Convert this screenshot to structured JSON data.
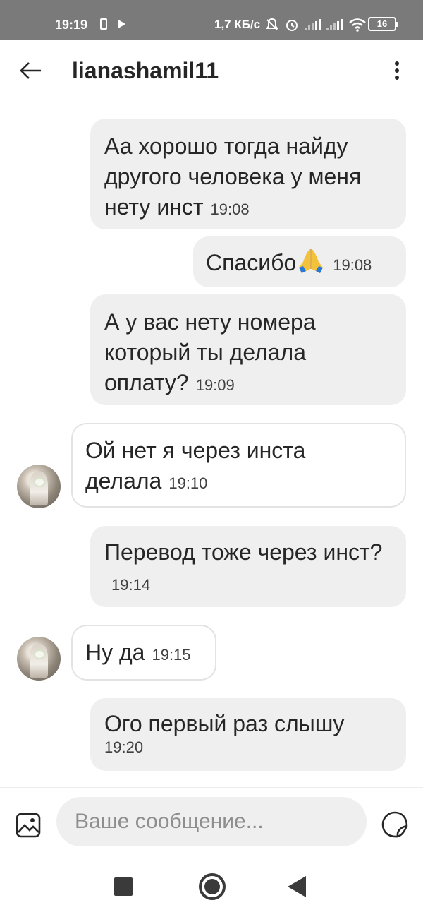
{
  "status_bar": {
    "time": "19:19",
    "network_speed": "1,7 КБ/с",
    "battery": "16"
  },
  "header": {
    "title": "lianashamil11"
  },
  "messages": [
    {
      "direction": "outgoing",
      "text": "Аа хорошо тогда найду другого человека у меня нету инст",
      "time": "19:08"
    },
    {
      "direction": "outgoing",
      "text": "Спасибо",
      "time": "19:08",
      "emoji": "folded-hands"
    },
    {
      "direction": "outgoing",
      "text": "А у вас нету номера который ты делала оплату?",
      "time": "19:09"
    },
    {
      "direction": "incoming",
      "text": "Ой нет я через инста делала",
      "time": "19:10"
    },
    {
      "direction": "outgoing",
      "text": "Перевод тоже через инст?",
      "time": "19:14"
    },
    {
      "direction": "incoming",
      "text": "Ну да",
      "time": "19:15"
    },
    {
      "direction": "outgoing",
      "text": "Ого первый раз слышу",
      "time": "19:20"
    }
  ],
  "composer": {
    "placeholder": "Ваше сообщение..."
  },
  "icons": {
    "back": "arrow-left-icon",
    "menu": "more-vertical-icon",
    "gallery": "image-icon",
    "sticker": "sticker-icon",
    "nav_recents": "square-icon",
    "nav_home": "home-circle-icon",
    "nav_back": "triangle-back-icon"
  },
  "colors": {
    "status_bar": "#7a7a7a",
    "outgoing_bubble": "#efefef",
    "incoming_border": "#e3e3e3",
    "text": "#262626"
  }
}
